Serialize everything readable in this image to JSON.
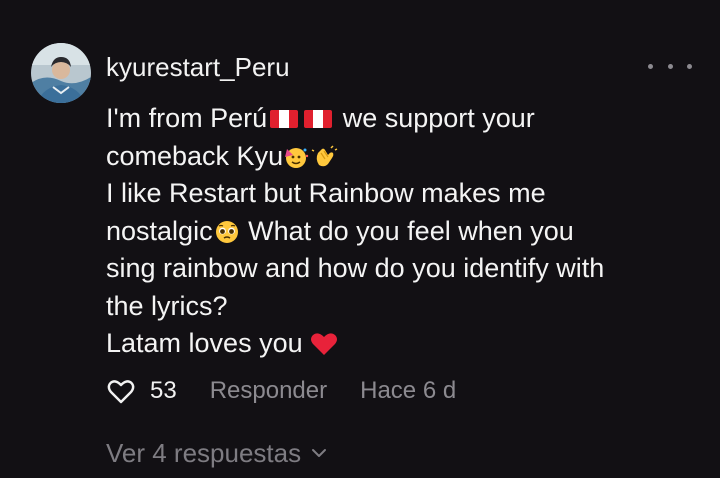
{
  "comment": {
    "username": "kyurestart_Peru",
    "avatar_icon": "profile-photo",
    "lines": {
      "l1a": "I'm from Perú",
      "l1b": "we support your",
      "l2": "comeback Kyu",
      "l3": "I like Restart but Rainbow makes me",
      "l4a": "nostalgic",
      "l4b": "What do you feel when you",
      "l5": "sing rainbow and how do you identify with",
      "l6": "the lyrics?",
      "l7": "Latam loves you"
    },
    "emojis": [
      "peru-flag-icon",
      "peru-flag-icon",
      "party-face-icon",
      "clapping-hands-icon",
      "pleading-face-icon",
      "red-heart-icon"
    ]
  },
  "actions": {
    "like_icon": "heart-outline-icon",
    "like_count": "53",
    "reply_label": "Responder",
    "timestamp": "Hace 6 d"
  },
  "replies": {
    "label": "Ver 4 respuestas",
    "icon": "chevron-down-icon"
  },
  "colors": {
    "background": "#121014",
    "primary_text": "#f2f2f2",
    "secondary_text": "#8c8a90",
    "heart_red": "#e8223a"
  }
}
